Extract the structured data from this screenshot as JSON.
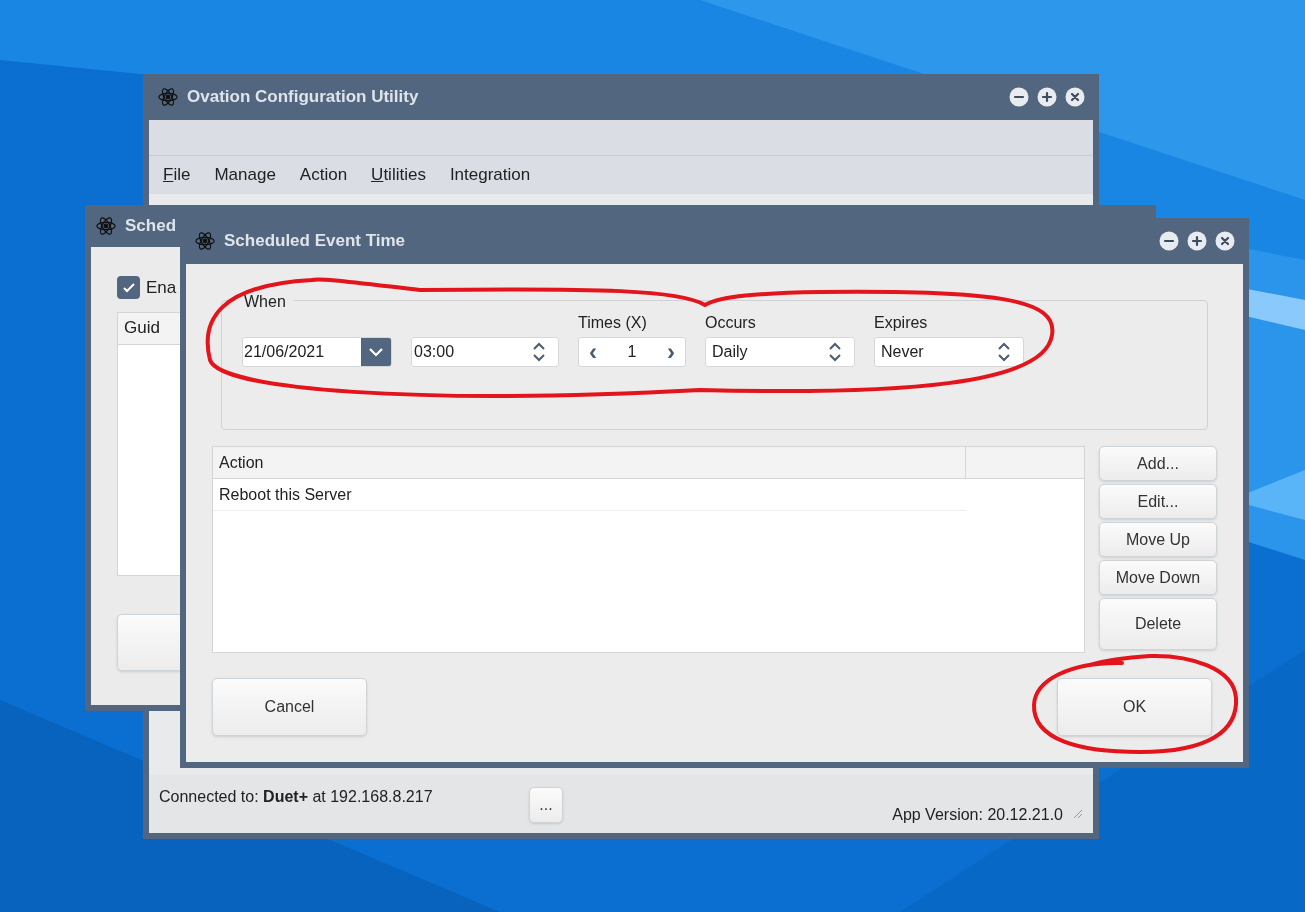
{
  "main_window": {
    "title": "Ovation Configuration Utility",
    "menu": [
      {
        "label": "File",
        "underline_first": true
      },
      {
        "label": "Manage",
        "underline_first": false
      },
      {
        "label": "Action",
        "underline_first": false
      },
      {
        "label": "Utilities",
        "underline_first": true
      },
      {
        "label": "Integration",
        "underline_first": false
      }
    ],
    "status_bar": {
      "connection": "Connected to: **Duet+** at 192.168.8.217",
      "more_button": "...",
      "version": "App Version: 20.12.21.0"
    }
  },
  "back_dialog": {
    "title": "Sched",
    "enable_checkbox": {
      "label": "Ena",
      "checked": true
    },
    "list_column": "Guid"
  },
  "event_dialog": {
    "title": "Scheduled Event Time",
    "when": {
      "label": "When",
      "date": "21/06/2021",
      "time": "03:00",
      "times": {
        "label": "Times (X)",
        "value": "1",
        "prev": "‹",
        "next": "›"
      },
      "occurs": {
        "label": "Occurs",
        "value": "Daily"
      },
      "expires": {
        "label": "Expires",
        "value": "Never"
      }
    },
    "table": {
      "columns": [
        "Action"
      ],
      "rows": [
        [
          "Reboot this Server"
        ]
      ]
    },
    "side_buttons": [
      "Add...",
      "Edit...",
      "Move Up",
      "Move Down",
      "Delete"
    ],
    "cancel": "Cancel",
    "ok": "OK"
  }
}
